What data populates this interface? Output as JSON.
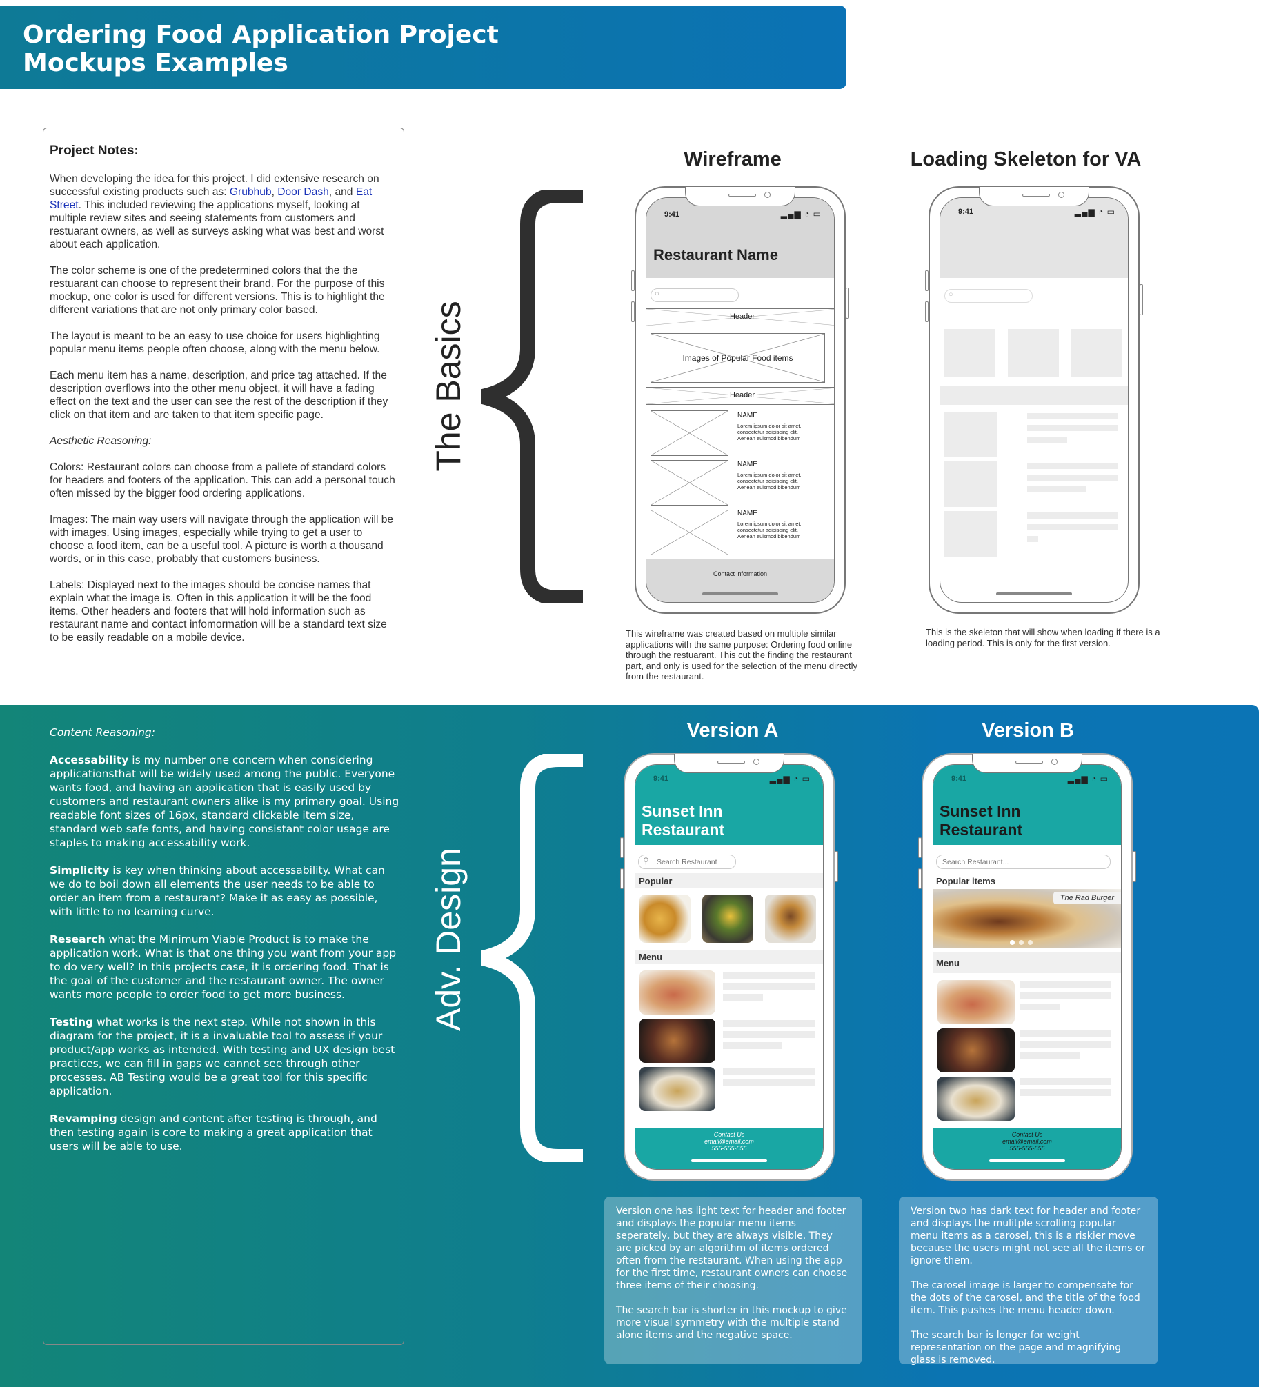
{
  "title": "Ordering Food Application Project\nMockups Examples",
  "notes": {
    "heading": "Project Notes:",
    "p1_a": "When developing the idea for this project. I did extensive research on successful existing products such as: ",
    "link1": "Grubhub",
    "sep1": ", ",
    "link2": "Door Dash",
    "sep2": ", and ",
    "link3": "Eat Street",
    "p1_b": ". This included reviewing the applications myself, looking at multiple review sites and seeing statements from customers and restuarant owners, as well as surveys asking what was best and worst about each application.",
    "p2": "The color scheme is one of the predetermined colors that the the restuarant can choose to represent their brand. For the purpose of this mockup, one color is used for different versions. This is to highlight the different variations that are not only primary color based.",
    "p3": "The layout is meant to be an easy to use choice for users highlighting popular menu items people often choose, along with the menu below.",
    "p4": "Each menu item has a name, description, and price tag attached. If the description overflows into the other menu object, it will have a fading effect on the text and the user can see the rest of the description if they click on that item and are taken to that item specific page.",
    "p5": "Aesthetic Reasoning:",
    "p6": "Colors: Restaurant colors can choose from a pallete of standard colors for headers and footers of the application. This can add a personal touch often missed by the bigger food ordering applications.",
    "p7": "Images: The main way users will navigate through the application will be with images. Using images, especially while trying to get a user to choose a food item, can be a useful tool. A picture is worth a thousand words, or in this case, probably that customers business.",
    "p8": "Labels: Displayed next to the images should be concise names that explain what the image is. Often in this application it will be the food items. Other headers and footers that will hold information such as restaurant name and contact infomormation will be a standard text size to be easily readable on a mobile device."
  },
  "content": {
    "heading": "Content Reasoning:",
    "b1": "Accessability",
    "t1": " is my number one concern when considering applicationsthat will be widely used among the public. Everyone wants food, and having an application that is easily used by customers and restaurant owners alike is my primary goal. Using readable font sizes of 16px, standard clickable item size, standard web safe fonts, and having consistant color usage are staples to making accessability work.",
    "b2": "Simplicity",
    "t2": " is key when thinking about accessability. What can we do to boil down all elements the user needs to be able to order an item from a restaurant? Make it as easy as possible, with little to no learning curve.",
    "b3": "Research",
    "t3": " what the Minimum Viable Product is to make the application work. What is that one thing you want from your app to do very well? In this projects case, it is ordering food. That is the goal of the customer and the restaurant owner. The owner wants more people to order food to get more business.",
    "b4": "Testing",
    "t4": " what works is the next step. While not shown in this diagram for the project, it is a invaluable tool to assess if your product/app works as intended. With testing and UX design best practices, we can fill in gaps we cannot see through other processes. AB Testing would be a great tool for this specific application.",
    "b5": "Revamping",
    "t5": " design and content after testing is through, and then testing again is core to making a great application that users will be able to use."
  },
  "section_basics": "The Basics",
  "section_adv": "Adv. Design",
  "wireframe": {
    "title": "Wireframe",
    "time": "9:41",
    "restaurant": "Restaurant Name",
    "header1": "Header",
    "popular": "Images of Popular Food items",
    "header2": "Header",
    "item_name": "NAME",
    "item_desc": "Lorem ipsum dolor sit amet, consectetur adipiscing elit. Aenean euismod bibendum",
    "contact": "Contact information",
    "desc": "This wireframe was created based on multiple similar applications with the same purpose: Ordering food online through the restuarant. This cut the finding the restaurant part, and only is used for the selection of the menu directly from the restaurant."
  },
  "skeleton": {
    "title": "Loading Skeleton for VA",
    "time": "9:41",
    "desc": "This is the skeleton that will show when loading if there is a loading period. This is only for the first version."
  },
  "versionA": {
    "title": "Version A",
    "time": "9:41",
    "restaurant": "Sunset Inn\nRestaurant",
    "search_placeholder": "Search Restaurant",
    "popular": "Popular",
    "menu": "Menu",
    "footer": "Contact Us\nemail@email.com\n555-555-555",
    "desc1": "Version one has light text for header and footer and displays the popular menu items seperately, but they are always visible. They are picked by an algorithm of items ordered often from the restaurant. When using the app for the first time, restaurant owners can choose three items of their choosing.",
    "desc2": "The search bar is shorter in this mockup to give more visual symmetry with the multiple stand alone items and the negative space.",
    "colors": {
      "header": "#19a7a4",
      "header_text": "#ffffff"
    }
  },
  "versionB": {
    "title": "Version B",
    "time": "9:41",
    "restaurant": "Sunset Inn\nRestaurant",
    "search_placeholder": "Search Restaurant...",
    "popular": "Popular items",
    "carousel_label": "The Rad Burger",
    "menu": "Menu",
    "footer": "Contact Us\nemail@email.com\n555-555-555",
    "desc1": "Version two has dark text for header and footer and displays the mulitple scrolling popular menu items as a carosel, this is a riskier move because the users might not see all the items or ignore them.",
    "desc2": "The carosel image is larger to compensate for the dots of the carosel, and the title of the food item. This pushes the menu header down.",
    "desc3": "The search bar is longer for weight representation on the page and magnifying glass is removed.",
    "colors": {
      "header": "#19a7a4",
      "header_text": "#1b1b1b"
    }
  }
}
